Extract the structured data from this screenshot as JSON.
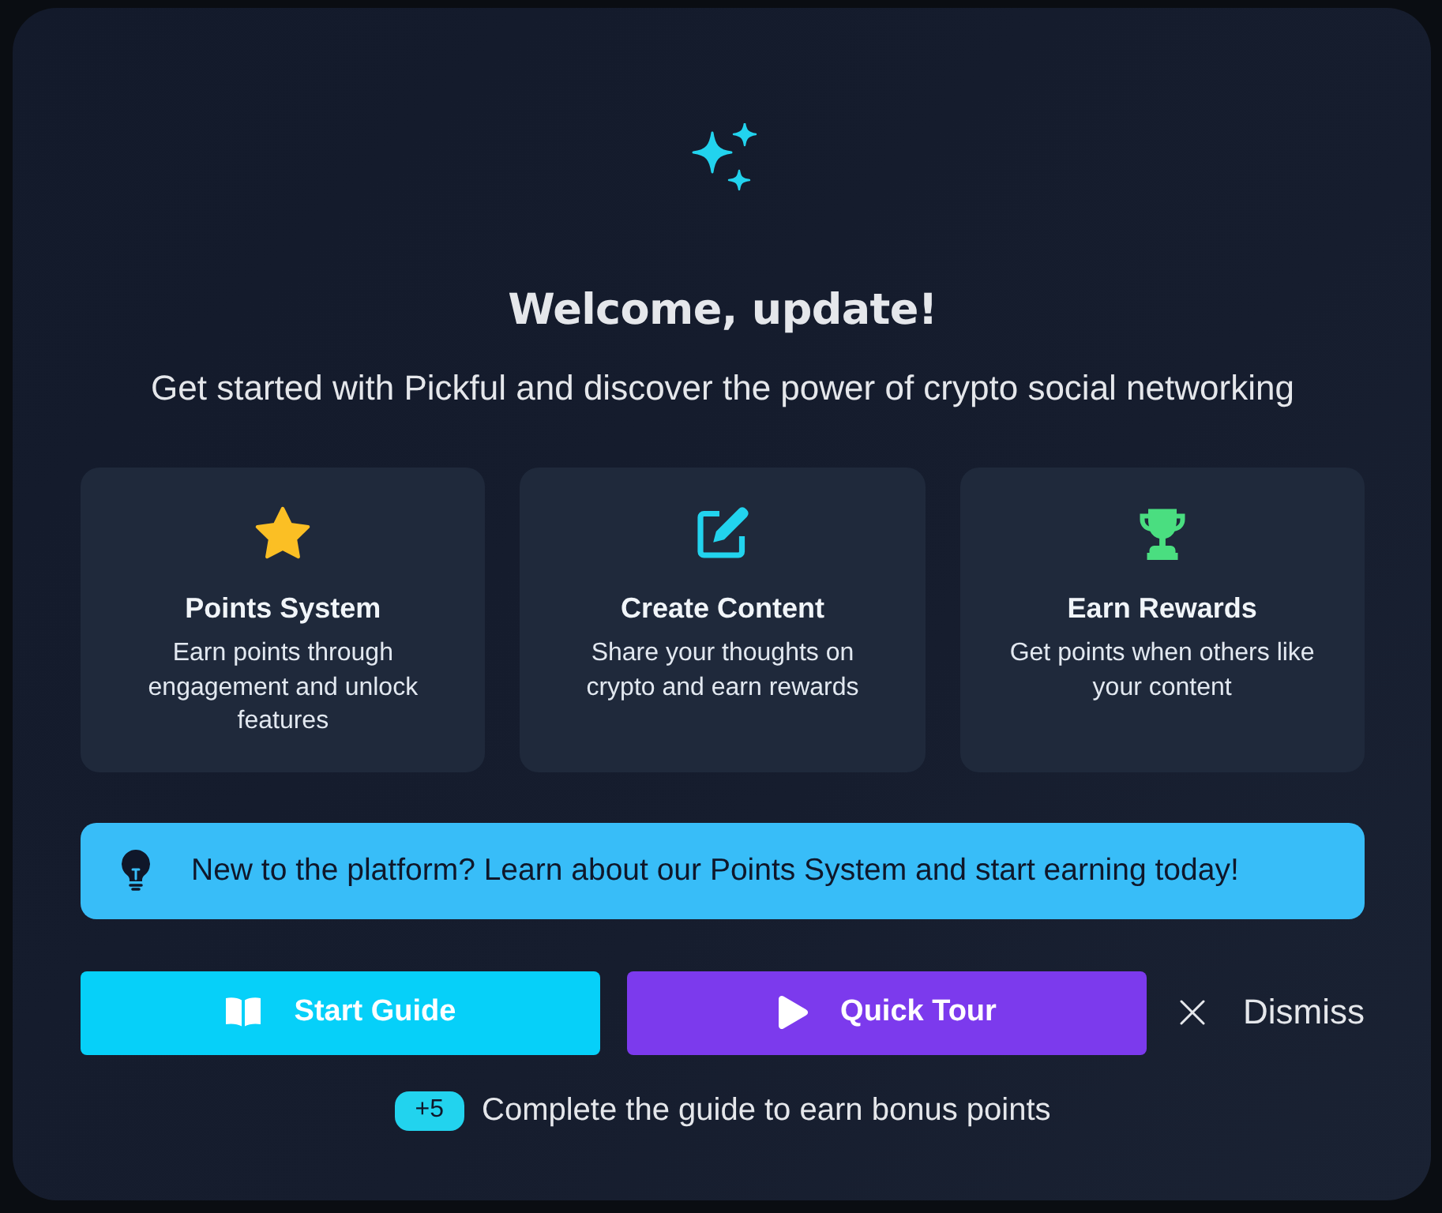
{
  "header": {
    "title": "Welcome, update!",
    "subtitle": "Get started with Pickful and discover the power of crypto social networking"
  },
  "features": [
    {
      "kind": "star",
      "title": "Points System",
      "description": "Earn points through engagement and unlock features"
    },
    {
      "kind": "edit",
      "title": "Create Content",
      "description": "Share your thoughts on crypto and earn rewards"
    },
    {
      "kind": "trophy",
      "title": "Earn Rewards",
      "description": "Get points when others like your content"
    }
  ],
  "tip": {
    "text": "New to the platform? Learn about our Points System and start earning today!"
  },
  "actions": [
    {
      "kind": "primary",
      "label": "Start Guide"
    },
    {
      "kind": "secondary",
      "label": "Quick Tour"
    },
    {
      "kind": "dismiss",
      "label": "Dismiss"
    }
  ],
  "footer": {
    "badge": "+5",
    "text": "Complete the guide to earn bonus points"
  }
}
